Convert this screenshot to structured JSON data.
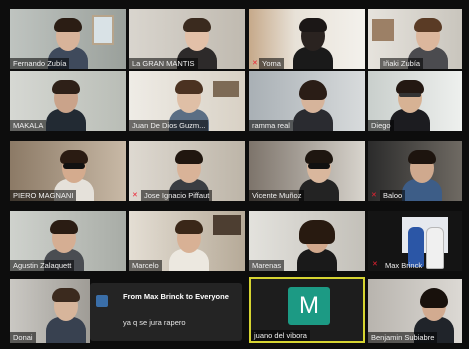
{
  "meeting": {
    "participants": [
      {
        "name": "Fernando Zubía",
        "muted": false
      },
      {
        "name": "La GRAN MANTIS",
        "muted": false
      },
      {
        "name": "Yoma",
        "muted": true
      },
      {
        "name": "Iñaki Zubía",
        "muted": false
      },
      {
        "name": "MAKALA",
        "muted": false
      },
      {
        "name": "Juan De Dios Guzm...",
        "muted": false
      },
      {
        "name": "ramma real",
        "muted": false
      },
      {
        "name": "Diego",
        "muted": false
      },
      {
        "name": "PIERO MAGNANI",
        "muted": false
      },
      {
        "name": "Jose Ignacio Piffaut",
        "muted": true
      },
      {
        "name": "Vicente Muñoz",
        "muted": false
      },
      {
        "name": "Baloo",
        "muted": true
      },
      {
        "name": "Agustin Zalaquett",
        "muted": false
      },
      {
        "name": "Marcelo",
        "muted": false
      },
      {
        "name": "Marenas",
        "muted": false
      },
      {
        "name": "Max Brinck",
        "muted": true
      },
      {
        "name": "Donai",
        "muted": false
      },
      {
        "name": "juano del vibora",
        "muted": false,
        "avatar_letter": "M"
      },
      {
        "name": "Benjamin Subiabre",
        "muted": false
      }
    ],
    "chat_popup": {
      "title": "From Max Brinck to Everyone",
      "message": "ya q se jura rapero"
    },
    "colors": {
      "active_speaker_border": "#d6d431",
      "avatar_bg": "#1c9a84",
      "muted_icon": "#e22233"
    }
  }
}
